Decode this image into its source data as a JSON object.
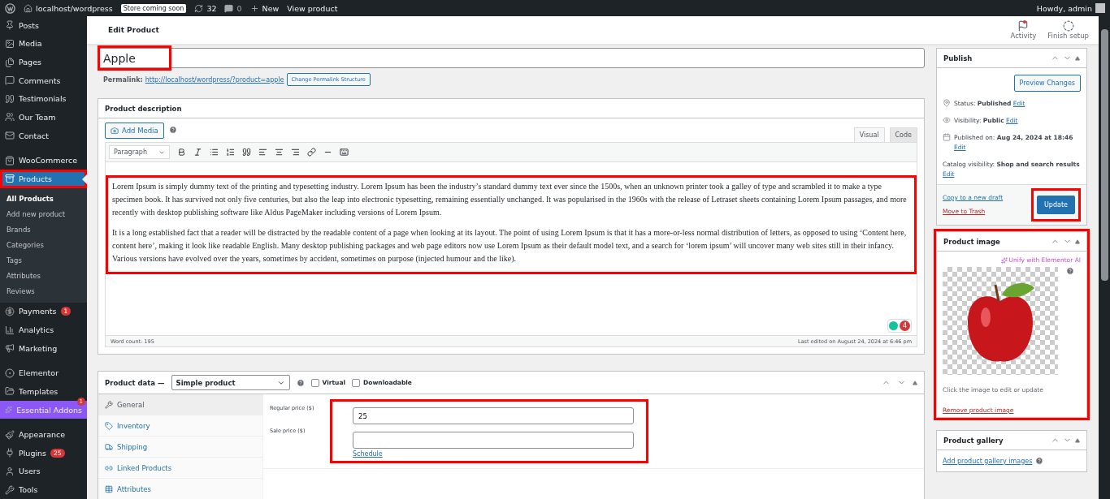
{
  "admin_bar": {
    "site": "localhost/wordpress",
    "store_badge": "Store coming soon",
    "updates": "32",
    "comments": "0",
    "new": "New",
    "view": "View product",
    "greeting": "Howdy, admin"
  },
  "sidebar": {
    "items": [
      {
        "label": "Posts",
        "selected": false,
        "highlighted": false,
        "group_start": false
      },
      {
        "label": "Media",
        "selected": false,
        "highlighted": false,
        "group_start": false
      },
      {
        "label": "Pages",
        "selected": false,
        "highlighted": false,
        "group_start": false
      },
      {
        "label": "Comments",
        "selected": false,
        "highlighted": false,
        "group_start": false
      },
      {
        "label": "Testimonials",
        "selected": false,
        "highlighted": false,
        "group_start": false
      },
      {
        "label": "Our Team",
        "selected": false,
        "highlighted": false,
        "group_start": false
      },
      {
        "label": "Contact",
        "selected": false,
        "highlighted": false,
        "group_start": false
      },
      {
        "label": "WooCommerce",
        "selected": false,
        "highlighted": false,
        "group_start": true
      },
      {
        "label": "Products",
        "selected": true,
        "highlighted": true,
        "group_start": false,
        "children": [
          {
            "label": "All Products",
            "selected": true
          },
          {
            "label": "Add new product",
            "selected": false
          },
          {
            "label": "Brands",
            "selected": false
          },
          {
            "label": "Categories",
            "selected": false
          },
          {
            "label": "Tags",
            "selected": false
          },
          {
            "label": "Attributes",
            "selected": false
          },
          {
            "label": "Reviews",
            "selected": false
          }
        ]
      },
      {
        "label": "Payments",
        "selected": false,
        "highlighted": false,
        "group_start": false,
        "badge": "1"
      },
      {
        "label": "Analytics",
        "selected": false,
        "highlighted": false,
        "group_start": false
      },
      {
        "label": "Marketing",
        "selected": false,
        "highlighted": false,
        "group_start": false
      },
      {
        "label": "Elementor",
        "selected": false,
        "highlighted": false,
        "group_start": true
      },
      {
        "label": "Templates",
        "selected": false,
        "highlighted": false,
        "group_start": false
      },
      {
        "label": "Essential Addons",
        "selected": false,
        "highlighted": false,
        "group_start": false,
        "color": "#8c58f5",
        "corner_badge": "1"
      },
      {
        "label": "Appearance",
        "selected": false,
        "highlighted": false,
        "group_start": true
      },
      {
        "label": "Plugins",
        "selected": false,
        "highlighted": false,
        "group_start": false,
        "badge": "25"
      },
      {
        "label": "Users",
        "selected": false,
        "highlighted": false,
        "group_start": false
      },
      {
        "label": "Tools",
        "selected": false,
        "highlighted": false,
        "group_start": false
      }
    ]
  },
  "header": {
    "title": "Edit Product",
    "actions": [
      {
        "label": "Activity",
        "notification": true
      },
      {
        "label": "Finish setup",
        "notification": false
      }
    ]
  },
  "title_field": {
    "value": "Apple",
    "highlighted": true
  },
  "permalink": {
    "label": "Permalink:",
    "url": "http://localhost/wordpress/?product=apple",
    "button": "Change Permalink Structure"
  },
  "description": {
    "title": "Product description",
    "add_media": "Add Media",
    "tabs": [
      {
        "label": "Visual",
        "selected": true
      },
      {
        "label": "Code",
        "selected": false
      }
    ],
    "format": "Paragraph",
    "highlighted": true,
    "paragraphs": [
      "Lorem Ipsum is simply dummy text of the printing and typesetting industry. Lorem Ipsum has been the industry’s standard dummy text ever since the 1500s, when an unknown printer took a galley of type and scrambled it to make a type specimen book. It has survived not only five centuries, but also the leap into electronic typesetting, remaining essentially unchanged. It was popularised in the 1960s with the release of Letraset sheets containing Lorem Ipsum passages, and more recently with desktop publishing software like Aldus PageMaker including versions of Lorem Ipsum.",
      "It is a long established fact that a reader will be distracted by the readable content of a page when looking at its layout. The point of using Lorem Ipsum is that it has a more-or-less normal distribution of letters, as opposed to using ‘Content here, content here’, making it look like readable English. Many desktop publishing packages and web page editors now use Lorem Ipsum as their default model text, and a search for ‘lorem ipsum’ will uncover many web sites still in their infancy. Various versions have evolved over the years, sometimes by accident, sometimes on purpose (injected humour and the like)."
    ],
    "grammar_count": "4",
    "word_count": "Word count: 195",
    "last_edited": "Last edited on August 24, 2024 at 6:46 pm"
  },
  "product_data": {
    "title": "Product data —",
    "type": "Simple product",
    "options": [
      {
        "label": "Virtual",
        "checked": false
      },
      {
        "label": "Downloadable",
        "checked": false
      }
    ],
    "tabs": [
      {
        "label": "General",
        "selected": true
      },
      {
        "label": "Inventory",
        "selected": false
      },
      {
        "label": "Shipping",
        "selected": false
      },
      {
        "label": "Linked Products",
        "selected": false
      },
      {
        "label": "Attributes",
        "selected": false
      }
    ],
    "fields": [
      {
        "label": "Regular price ($)",
        "value": "25"
      },
      {
        "label": "Sale price ($)"
      }
    ],
    "schedule": "Schedule",
    "highlighted": true
  },
  "publish": {
    "title": "Publish",
    "preview": "Preview Changes",
    "rows": [
      {
        "kind": "inline",
        "label": "Status:",
        "value": "Published",
        "link": "Edit"
      },
      {
        "kind": "inline",
        "label": "Visibility:",
        "value": "Public",
        "link": "Edit"
      },
      {
        "kind": "block",
        "label": "Published on:",
        "value": "Aug 24, 2024 at 18:46",
        "link": "Edit"
      },
      {
        "kind": "block",
        "label": "Catalog visibility:",
        "value": "Shop and search results",
        "link": "Edit"
      }
    ],
    "copy": "Copy to a new draft",
    "trash": "Move to Trash",
    "update": "Update",
    "update_highlighted": true
  },
  "product_image": {
    "title": "Product image",
    "ai": "Unify with Elementor AI",
    "hint": "Click the image to edit or update",
    "remove": "Remove product image",
    "highlighted": true
  },
  "gallery": {
    "title": "Product gallery",
    "add": "Add product gallery images"
  }
}
